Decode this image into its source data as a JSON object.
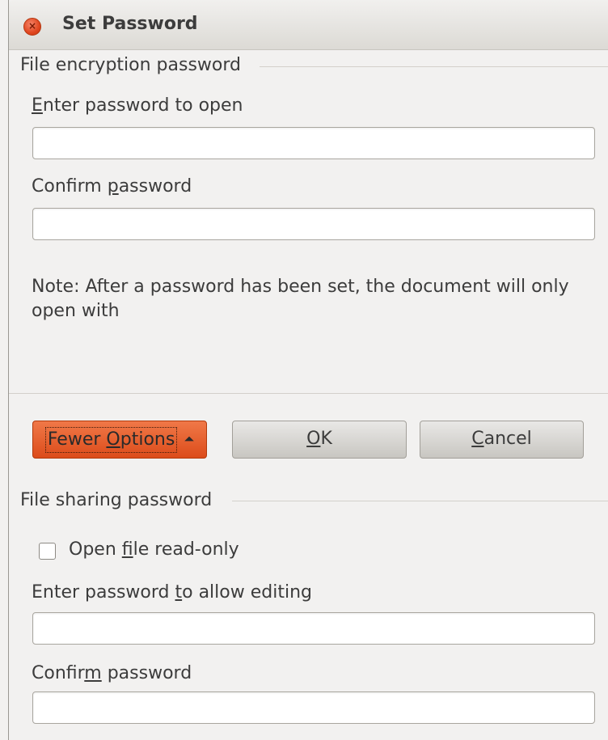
{
  "dialog": {
    "title": "Set Password",
    "close_glyph": "×"
  },
  "encryption": {
    "section_label": "File encryption password",
    "open_label_mnemonic": "E",
    "open_label_rest": "nter password to open",
    "open_value": "",
    "confirm_label_pre": "Confirm ",
    "confirm_label_mnemonic": "p",
    "confirm_label_rest": "assword",
    "confirm_value": "",
    "note": "Note: After a password has been set, the document will only open with"
  },
  "buttons": {
    "fewer_pre": "Fewer ",
    "fewer_mnemonic": "O",
    "fewer_rest": "ptions",
    "fewer_arrow": "⏶",
    "ok_mnemonic": "O",
    "ok_rest": "K",
    "cancel_mnemonic": "C",
    "cancel_rest": "ancel"
  },
  "sharing": {
    "section_label": "File sharing password",
    "readonly_pre": "Open ",
    "readonly_mnemonic": "f",
    "readonly_rest": "ile read-only",
    "readonly_checked": false,
    "edit_label_pre": "Enter password ",
    "edit_label_mnemonic": "t",
    "edit_label_rest": "o allow editing",
    "edit_value": "",
    "confirm_label_pre": "Confir",
    "confirm_label_mnemonic": "m",
    "confirm_label_rest": " password",
    "confirm_value": ""
  },
  "colors": {
    "accent_button": "#dc4c1b",
    "close_button": "#e0461f",
    "dialog_background": "#f2f1f0"
  }
}
